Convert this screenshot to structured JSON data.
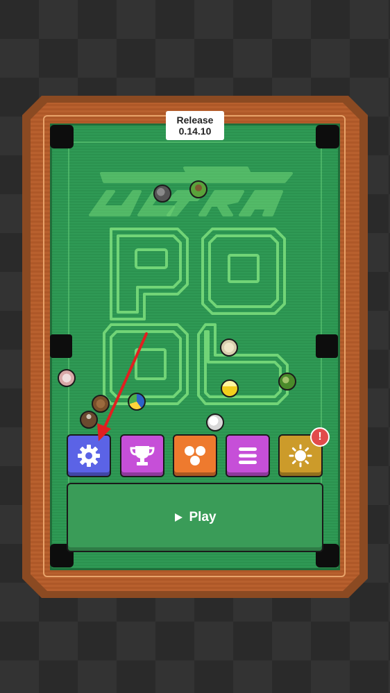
{
  "version_badge": {
    "line1": "Release",
    "line2": "0.14.10"
  },
  "logo": {
    "word1": "ULTRA",
    "word2": "POOL"
  },
  "menu": [
    {
      "id": "settings",
      "icon": "gear-icon",
      "color": "#5b63e6"
    },
    {
      "id": "trophies",
      "icon": "trophy-icon",
      "color": "#c64fd8"
    },
    {
      "id": "balls",
      "icon": "balls-icon",
      "color": "#ee7a2e"
    },
    {
      "id": "menu",
      "icon": "list-icon",
      "color": "#c64fd8"
    },
    {
      "id": "theme",
      "icon": "sun-icon",
      "color": "#cc9b2a",
      "badge": "!"
    }
  ],
  "play": {
    "label": "Play",
    "icon": "play-icon"
  },
  "colors": {
    "felt": "#2f9a55",
    "wood": "#b8602e",
    "neon": "#7ee07e",
    "arrow": "#e02020"
  }
}
